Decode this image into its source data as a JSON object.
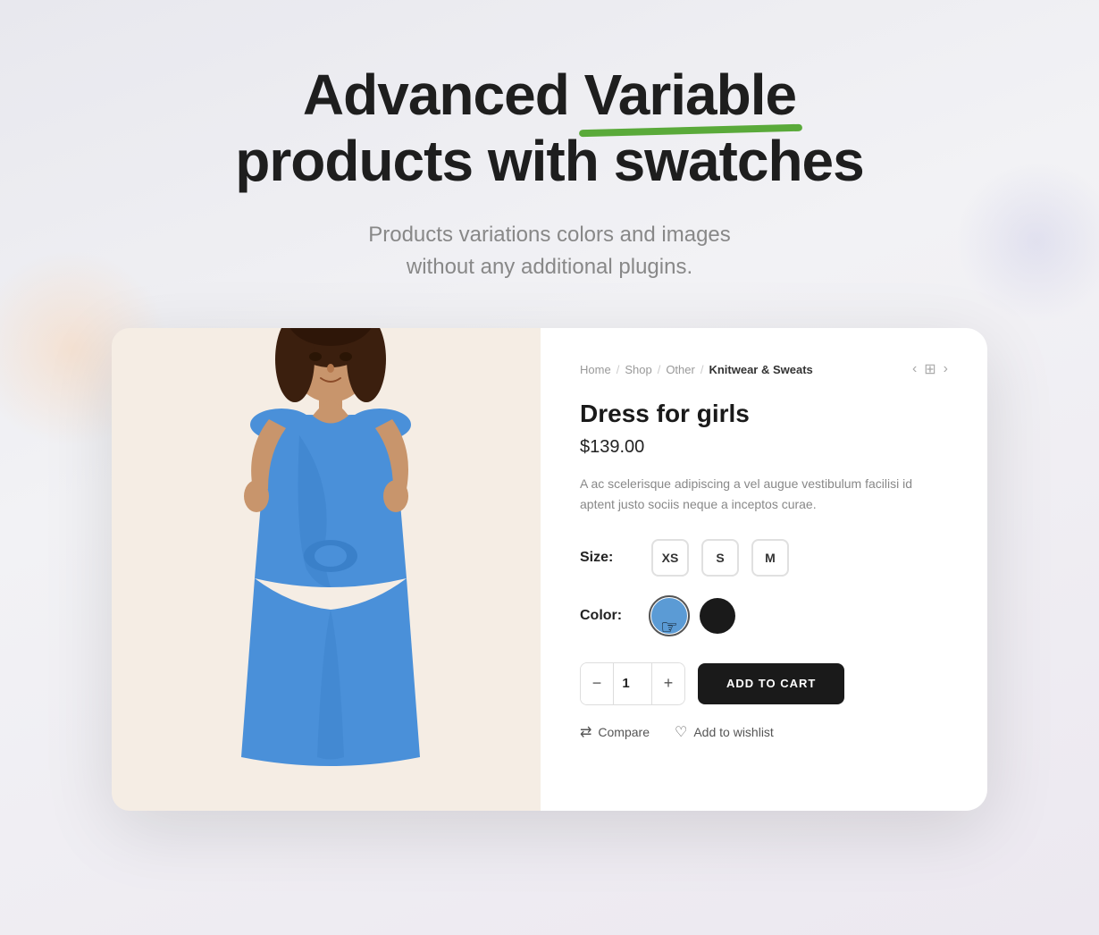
{
  "page": {
    "background": "#f0f0f3"
  },
  "header": {
    "title_part1": "Advanced ",
    "title_highlight": "Variable",
    "title_part2": "products with swatches",
    "subtitle_line1": "Products variations colors and images",
    "subtitle_line2": "without any additional plugins."
  },
  "breadcrumb": {
    "home": "Home",
    "sep1": "/",
    "shop": "Shop",
    "sep2": "/",
    "other": "Other",
    "sep3": "/",
    "current": "Knitwear & Sweats"
  },
  "product": {
    "name": "Dress for girls",
    "price": "$139.00",
    "description": "A ac scelerisque adipiscing a vel augue vestibulum facilisi id aptent justo sociis neque a inceptos curae.",
    "size_label": "Size:",
    "sizes": [
      "XS",
      "S",
      "M"
    ],
    "color_label": "Color:",
    "colors": [
      {
        "name": "blue",
        "hex": "#5b9bd5",
        "selected": true
      },
      {
        "name": "black",
        "hex": "#1a1a1a",
        "selected": false
      }
    ],
    "qty": "1",
    "add_to_cart": "ADD TO CART",
    "compare_label": "Compare",
    "wishlist_label": "Add to wishlist"
  },
  "nav": {
    "prev_icon": "‹",
    "grid_icon": "⊞",
    "next_icon": "›"
  }
}
